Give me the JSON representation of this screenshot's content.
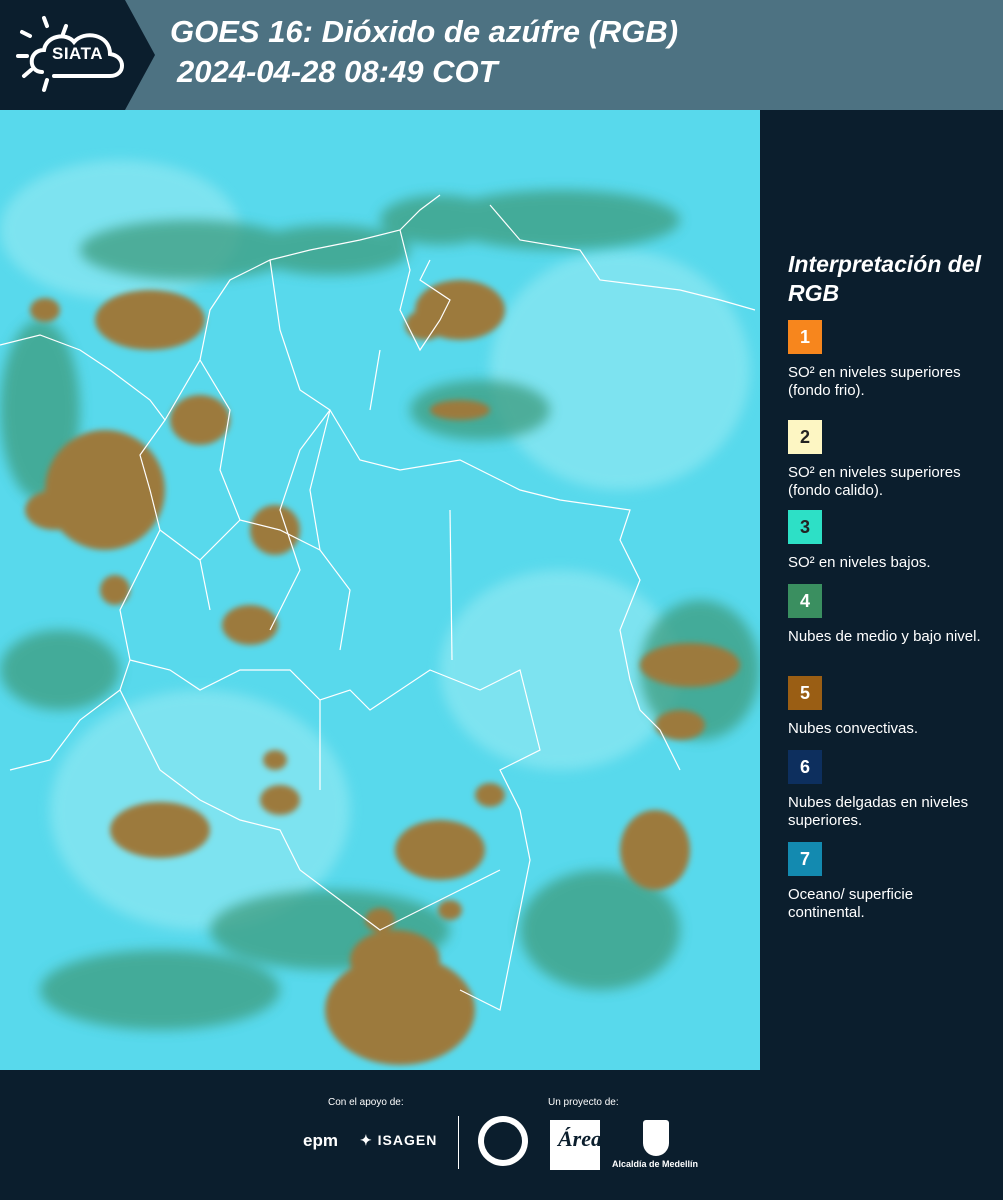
{
  "header": {
    "logo_text": "SIATA",
    "title_line1": "GOES 16: Dióxido de azúfre (RGB)",
    "title_line2": "2024-04-28 08:49 COT"
  },
  "legend": {
    "title": "Interpretación del RGB",
    "items": [
      {
        "number": "1",
        "color": "#f7861d",
        "text_color": "#ffffff",
        "label": "SO² en niveles superiores (fondo frio)."
      },
      {
        "number": "2",
        "color": "#fdf6c3",
        "text_color": "#222222",
        "label": "SO² en niveles superiores (fondo calido)."
      },
      {
        "number": "3",
        "color": "#2de0c6",
        "text_color": "#222222",
        "label": "SO² en niveles bajos."
      },
      {
        "number": "4",
        "color": "#3a8f60",
        "text_color": "#ffffff",
        "label": "Nubes de medio y bajo nivel."
      },
      {
        "number": "5",
        "color": "#9a5e14",
        "text_color": "#ffffff",
        "label": "Nubes convectivas."
      },
      {
        "number": "6",
        "color": "#0d2f5e",
        "text_color": "#ffffff",
        "label": "Nubes delgadas en niveles superiores."
      },
      {
        "number": "7",
        "color": "#138ab0",
        "text_color": "#ffffff",
        "label": "Oceano/ superficie continental."
      }
    ]
  },
  "footer": {
    "support_label": "Con el apoyo de:",
    "project_label": "Un proyecto de:",
    "epm": "epm",
    "isagen": "ISAGEN",
    "area_label": "Área",
    "alcaldia": "Alcaldía de Medellín"
  },
  "map": {
    "colors": {
      "background": "#58d9ec",
      "convective": "#9c7a3e",
      "midlevel": "#3c9c7e",
      "borders": "#ffffff"
    }
  }
}
